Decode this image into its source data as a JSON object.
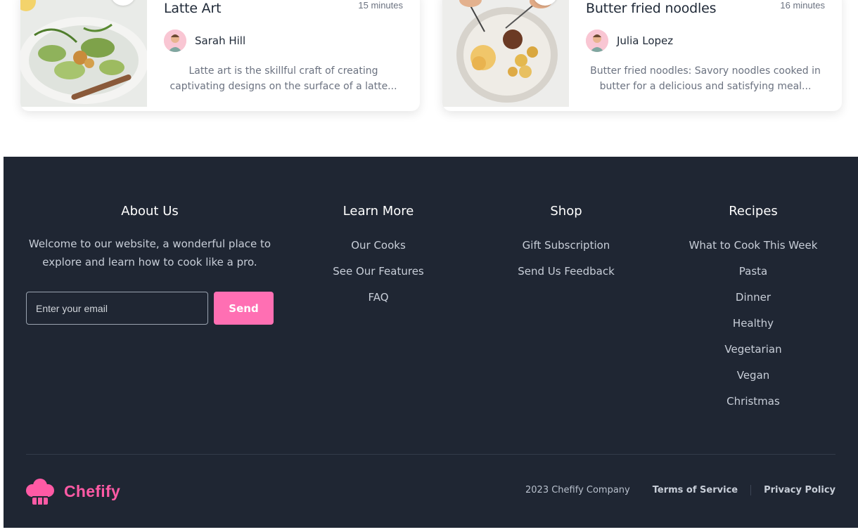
{
  "cards": [
    {
      "title": "Latte Art",
      "time": "15 minutes",
      "author": "Sarah Hill",
      "description": "Latte art is the skillful craft of creating captivating designs on the surface of a latte..."
    },
    {
      "title": "Butter fried noodles",
      "time": "16 minutes",
      "author": "Julia Lopez",
      "description": "Butter fried noodles: Savory noodles cooked in butter for a delicious and satisfying meal..."
    }
  ],
  "footer": {
    "about": {
      "heading": "About Us",
      "text": "Welcome to our website, a wonderful place to explore and learn how to cook like a pro.",
      "email_placeholder": "Enter your email",
      "send_label": "Send"
    },
    "learn_more": {
      "heading": "Learn More",
      "links": [
        "Our Cooks",
        "See Our Features",
        "FAQ"
      ]
    },
    "shop": {
      "heading": "Shop",
      "links": [
        "Gift Subscription",
        "Send Us Feedback"
      ]
    },
    "recipes": {
      "heading": "Recipes",
      "links": [
        "What to Cook This Week",
        "Pasta",
        "Dinner",
        "Healthy",
        "Vegetarian",
        "Vegan",
        "Christmas"
      ]
    },
    "brand_name": "Chefify",
    "copyright": "2023 Chefify Company",
    "terms": "Terms of Service",
    "privacy": "Privacy Policy"
  },
  "colors": {
    "footer_bg": "#1f2633",
    "accent": "#ff6fb3",
    "brand": "#ff5aa5"
  }
}
